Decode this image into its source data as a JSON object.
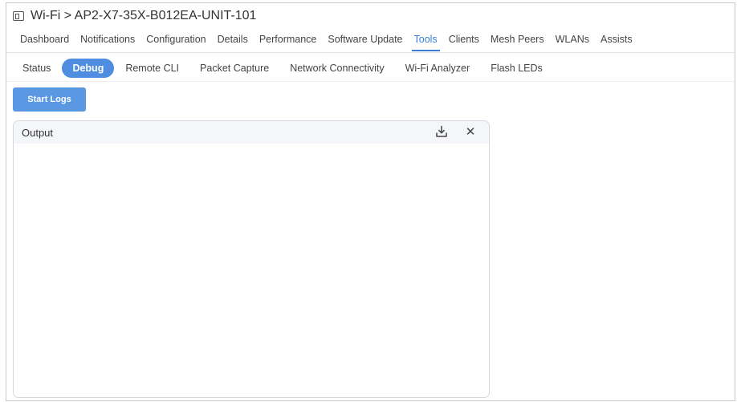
{
  "breadcrumb": {
    "text": "Wi-Fi > AP2-X7-35X-B012EA-UNIT-101"
  },
  "primary_tabs": [
    {
      "label": "Dashboard"
    },
    {
      "label": "Notifications"
    },
    {
      "label": "Configuration"
    },
    {
      "label": "Details"
    },
    {
      "label": "Performance"
    },
    {
      "label": "Software Update"
    },
    {
      "label": "Tools"
    },
    {
      "label": "Clients"
    },
    {
      "label": "Mesh Peers"
    },
    {
      "label": "WLANs"
    },
    {
      "label": "Assists"
    }
  ],
  "primary_tabs_active": "Tools",
  "secondary_tabs": [
    {
      "label": "Status"
    },
    {
      "label": "Debug"
    },
    {
      "label": "Remote CLI"
    },
    {
      "label": "Packet Capture"
    },
    {
      "label": "Network Connectivity"
    },
    {
      "label": "Wi-Fi Analyzer"
    },
    {
      "label": "Flash LEDs"
    }
  ],
  "secondary_tabs_active": "Debug",
  "start_logs_label": "Start Logs",
  "output": {
    "title": "Output"
  },
  "colors": {
    "accent": "#3a7fd5",
    "button": "#5a98e4"
  }
}
